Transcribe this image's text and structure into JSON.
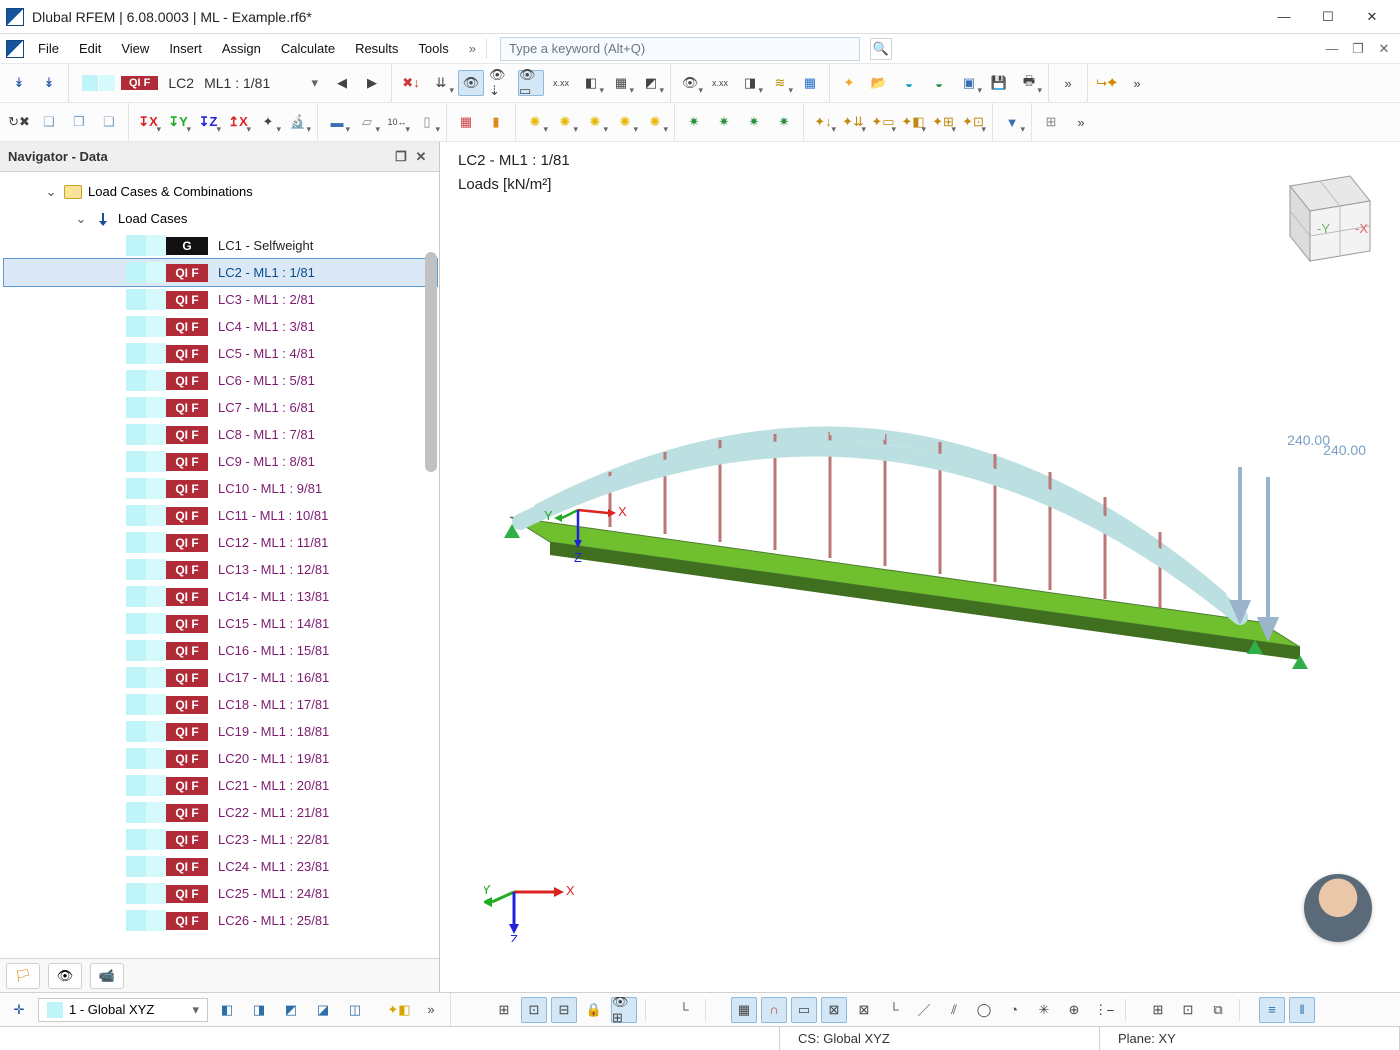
{
  "window": {
    "title": "Dlubal RFEM | 6.08.0003 | ML - Example.rf6*"
  },
  "menu": {
    "items": [
      "File",
      "Edit",
      "View",
      "Insert",
      "Assign",
      "Calculate",
      "Results",
      "Tools"
    ],
    "search_placeholder": "Type a keyword (Alt+Q)"
  },
  "toolbar1": {
    "qif": "QI F",
    "lc_short": "LC2",
    "lc_long": "ML1 : 1/81"
  },
  "navigator": {
    "title": "Navigator - Data",
    "group": "Load Cases & Combinations",
    "subgroup": "Load Cases",
    "selected_index": 1,
    "items": [
      {
        "tag": "G",
        "tagClass": "g",
        "label": "LC1 - Selfweight",
        "rowClass": "g"
      },
      {
        "tag": "QI F",
        "tagClass": "qi",
        "label": "LC2 - ML1 : 1/81"
      },
      {
        "tag": "QI F",
        "tagClass": "qi",
        "label": "LC3 - ML1 : 2/81"
      },
      {
        "tag": "QI F",
        "tagClass": "qi",
        "label": "LC4 - ML1 : 3/81"
      },
      {
        "tag": "QI F",
        "tagClass": "qi",
        "label": "LC5 - ML1 : 4/81"
      },
      {
        "tag": "QI F",
        "tagClass": "qi",
        "label": "LC6 - ML1 : 5/81"
      },
      {
        "tag": "QI F",
        "tagClass": "qi",
        "label": "LC7 - ML1 : 6/81"
      },
      {
        "tag": "QI F",
        "tagClass": "qi",
        "label": "LC8 - ML1 : 7/81"
      },
      {
        "tag": "QI F",
        "tagClass": "qi",
        "label": "LC9 - ML1 : 8/81"
      },
      {
        "tag": "QI F",
        "tagClass": "qi",
        "label": "LC10 - ML1 : 9/81"
      },
      {
        "tag": "QI F",
        "tagClass": "qi",
        "label": "LC11 - ML1 : 10/81"
      },
      {
        "tag": "QI F",
        "tagClass": "qi",
        "label": "LC12 - ML1 : 11/81"
      },
      {
        "tag": "QI F",
        "tagClass": "qi",
        "label": "LC13 - ML1 : 12/81"
      },
      {
        "tag": "QI F",
        "tagClass": "qi",
        "label": "LC14 - ML1 : 13/81"
      },
      {
        "tag": "QI F",
        "tagClass": "qi",
        "label": "LC15 - ML1 : 14/81"
      },
      {
        "tag": "QI F",
        "tagClass": "qi",
        "label": "LC16 - ML1 : 15/81"
      },
      {
        "tag": "QI F",
        "tagClass": "qi",
        "label": "LC17 - ML1 : 16/81"
      },
      {
        "tag": "QI F",
        "tagClass": "qi",
        "label": "LC18 - ML1 : 17/81"
      },
      {
        "tag": "QI F",
        "tagClass": "qi",
        "label": "LC19 - ML1 : 18/81"
      },
      {
        "tag": "QI F",
        "tagClass": "qi",
        "label": "LC20 - ML1 : 19/81"
      },
      {
        "tag": "QI F",
        "tagClass": "qi",
        "label": "LC21 - ML1 : 20/81"
      },
      {
        "tag": "QI F",
        "tagClass": "qi",
        "label": "LC22 - ML1 : 21/81"
      },
      {
        "tag": "QI F",
        "tagClass": "qi",
        "label": "LC23 - ML1 : 22/81"
      },
      {
        "tag": "QI F",
        "tagClass": "qi",
        "label": "LC24 - ML1 : 23/81"
      },
      {
        "tag": "QI F",
        "tagClass": "qi",
        "label": "LC25 - ML1 : 24/81"
      },
      {
        "tag": "QI F",
        "tagClass": "qi",
        "label": "LC26 - ML1 : 25/81"
      }
    ]
  },
  "viewport": {
    "title": "LC2 - ML1 : 1/81",
    "units": "Loads [kN/m²]",
    "load_value_1": "240.00",
    "load_value_2": "240.00",
    "axis": {
      "x": "X",
      "y": "Y",
      "z": "Z"
    },
    "cube": {
      "x": "-X",
      "y": "-Y"
    }
  },
  "bottombar": {
    "coord_system": "1 - Global XYZ"
  },
  "statusbar": {
    "cs": "CS: Global XYZ",
    "plane": "Plane: XY"
  }
}
